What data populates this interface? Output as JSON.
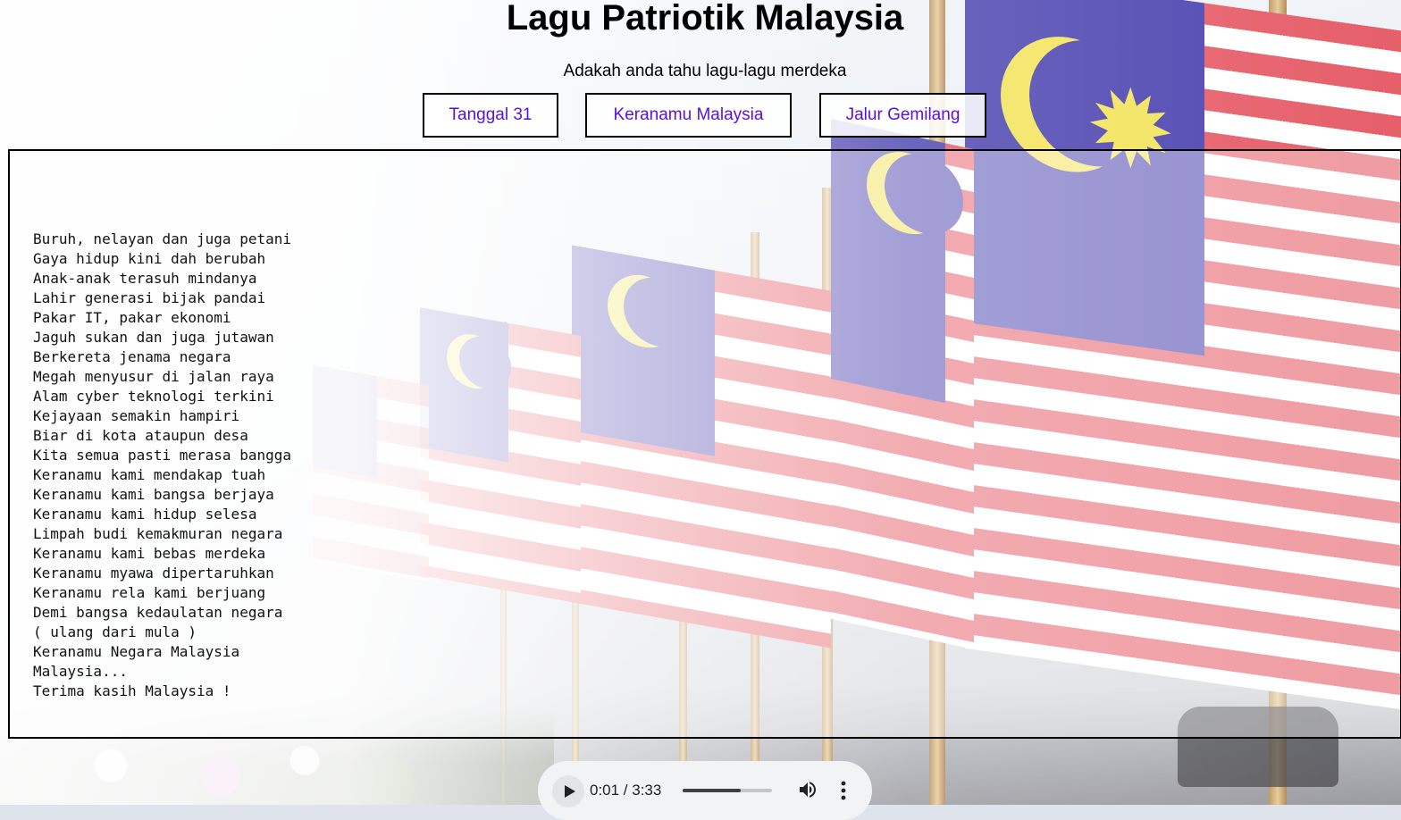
{
  "header": {
    "title": "Lagu Patriotik Malaysia",
    "subtitle": "Adakah anda tahu lagu-lagu merdeka"
  },
  "song_buttons": [
    {
      "label": "Tanggal 31"
    },
    {
      "label": "Keranamu Malaysia"
    },
    {
      "label": "Jalur Gemilang"
    }
  ],
  "colors": {
    "button_text": "#5a10d8",
    "flag_red": "#e34d59",
    "flag_blue": "#3b32a8",
    "flag_yellow": "#f2e14a"
  },
  "lyrics": {
    "lines": [
      "Buruh, nelayan dan juga petani",
      "Gaya hidup kini dah berubah",
      "Anak-anak terasuh mindanya",
      "Lahir generasi bijak pandai",
      "Pakar IT, pakar ekonomi",
      "Jaguh sukan dan juga jutawan",
      "Berkereta jenama negara",
      "Megah menyusur di jalan raya",
      "Alam cyber teknologi terkini",
      "Kejayaan semakin hampiri",
      "Biar di kota ataupun desa",
      "Kita semua pasti merasa bangga",
      "Keranamu kami mendakap tuah",
      "Keranamu kami bangsa berjaya",
      "Keranamu kami hidup selesa",
      "Limpah budi kemakmuran negara",
      "Keranamu kami bebas merdeka",
      "Keranamu myawa dipertaruhkan",
      "Keranamu rela kami berjuang",
      "Demi bangsa kedaulatan negara",
      "( ulang dari mula )",
      "Keranamu Negara Malaysia",
      "Malaysia...",
      "Terima kasih Malaysia !"
    ]
  },
  "audio_player": {
    "time_display": "0:01 / 3:33",
    "progress": 0.65,
    "icons": [
      "play-icon",
      "volume-icon",
      "more-options-icon"
    ]
  }
}
